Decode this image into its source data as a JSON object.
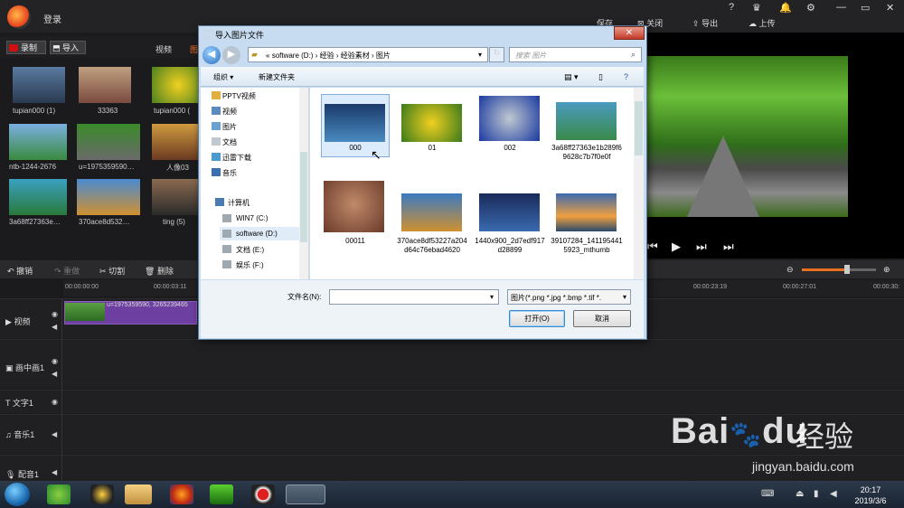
{
  "app": {
    "login": "登录",
    "top_buttons": [
      "保存",
      "关闭",
      "导出",
      "上传"
    ],
    "window_controls": [
      "?",
      "—",
      "▭",
      "✕"
    ],
    "toolbar": {
      "record": "录制",
      "import": "导入"
    },
    "tabs": [
      "视频",
      "图"
    ]
  },
  "media_items": [
    {
      "label": "tupian000 (1)"
    },
    {
      "label": "33363"
    },
    {
      "label": "tupian000 ("
    },
    {
      "label": "ntb-1244-2676"
    },
    {
      "label": "u=1975359590…"
    },
    {
      "label": "人像03"
    },
    {
      "label": "3a68ff27363e…"
    },
    {
      "label": "370ace8d532…"
    },
    {
      "label": "ting (5)"
    }
  ],
  "edit_bar": {
    "undo": "撤销",
    "redo": "重做",
    "cut": "切割",
    "delete": "删除"
  },
  "ruler": [
    "00:00:00:00",
    "00:00:03:11",
    "00:00:23:19",
    "00:00:27:01",
    "00:00:30:"
  ],
  "tracks": [
    "视频",
    "画中画1",
    "文字1",
    "音乐1",
    "配音1"
  ],
  "clip_label": "u=1975359590, 3265239465",
  "dialog": {
    "title": "导入图片文件",
    "close": "✕",
    "breadcrumb": [
      "«",
      "software (D:)",
      "›",
      "经验",
      "›",
      "经验素材",
      "›",
      "图片"
    ],
    "search_placeholder": "搜索 图片",
    "organize": "组织 ▾",
    "new_folder": "新建文件夹",
    "nav_items": [
      {
        "label": "PPTV视频",
        "icon": "folder-icon"
      },
      {
        "label": "视频",
        "icon": "video-library-icon"
      },
      {
        "label": "图片",
        "icon": "picture-library-icon"
      },
      {
        "label": "文档",
        "icon": "document-library-icon"
      },
      {
        "label": "迅雷下载",
        "icon": "download-icon"
      },
      {
        "label": "音乐",
        "icon": "music-library-icon"
      },
      {
        "label": "计算机",
        "icon": "computer-icon"
      },
      {
        "label": "WIN7 (C:)",
        "icon": "drive-icon"
      },
      {
        "label": "software (D:)",
        "icon": "drive-icon"
      },
      {
        "label": "文档 (E:)",
        "icon": "drive-icon"
      },
      {
        "label": "娱乐 (F:)",
        "icon": "drive-icon"
      }
    ],
    "files": [
      {
        "name": "000"
      },
      {
        "name": "01"
      },
      {
        "name": "002"
      },
      {
        "name": "3a68ff27363e1b289f69628c7b7f0e0f"
      },
      {
        "name": "00011"
      },
      {
        "name": "370ace8df53227a204d64c76ebad4620"
      },
      {
        "name": "1440x900_2d7edf917d28899"
      },
      {
        "name": "39107284_1411954415923_mthumb"
      }
    ],
    "filename_label": "文件名(N):",
    "filename_value": "",
    "filetype": "图片(*.png *.jpg *.bmp *.tif *.",
    "open": "打开(O)",
    "cancel": "取消"
  },
  "taskbar": {
    "time": "20:17",
    "date": "2019/3/6"
  },
  "watermark": {
    "brand": "Bai",
    "paw": "du",
    "cn": "经验",
    "url": "jingyan.baidu.com"
  }
}
